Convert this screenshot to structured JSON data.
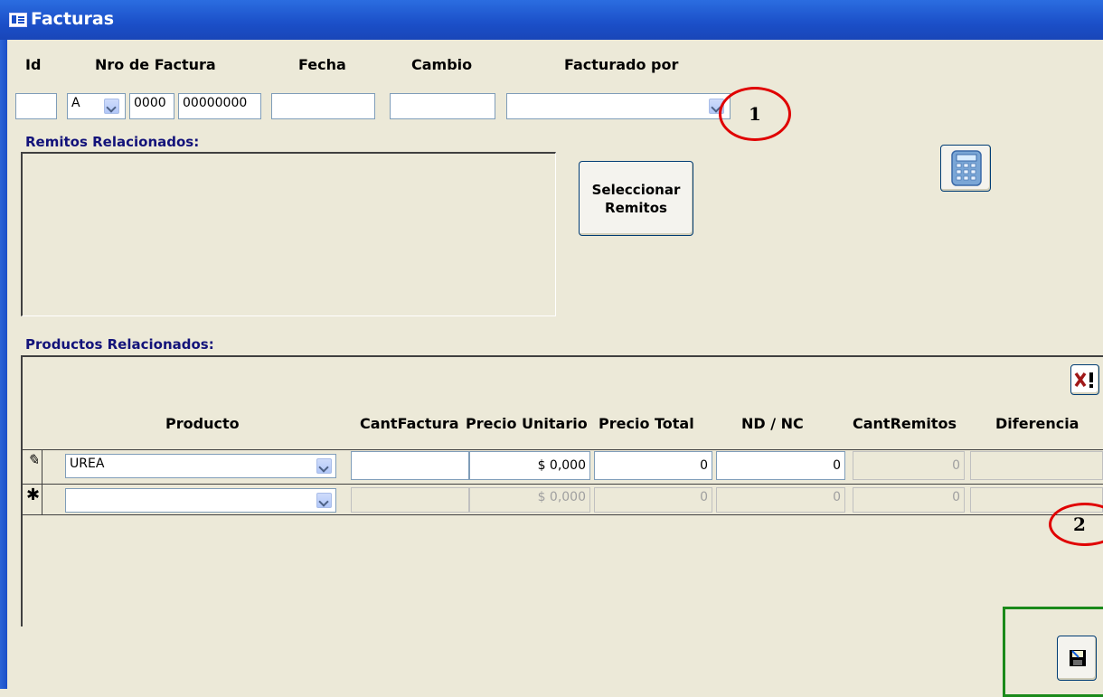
{
  "window": {
    "title": "Facturas"
  },
  "headers": {
    "id": "Id",
    "nro_factura": "Nro de Factura",
    "fecha": "Fecha",
    "cambio": "Cambio",
    "facturado_por": "Facturado por"
  },
  "fields": {
    "id": "",
    "tipo": "A",
    "punto_venta": "0000",
    "numero": "00000000",
    "fecha": "",
    "cambio": "",
    "facturado_por": ""
  },
  "remitos": {
    "label": "Remitos Relacionados:",
    "button": [
      "Seleccionar",
      "Remitos"
    ]
  },
  "productos": {
    "label": "Productos Relacionados:",
    "columns": [
      "Producto",
      "CantFactura",
      "Precio Unitario",
      "Precio Total",
      "ND / NC",
      "CantRemitos",
      "Diferencia"
    ],
    "rows": [
      {
        "selector": "✎",
        "producto": "UREA",
        "cant_factura": "",
        "precio_unitario": "$ 0,000",
        "precio_total": "0",
        "nd_nc": "0",
        "cant_remitos": "0",
        "diferencia": ""
      },
      {
        "selector": "✱",
        "producto": "",
        "cant_factura": "",
        "precio_unitario": "$ 0,000",
        "precio_total": "0",
        "nd_nc": "0",
        "cant_remitos": "0",
        "diferencia": ""
      }
    ]
  },
  "annotations": {
    "circle1": "1",
    "circle2": "2"
  },
  "icons": {
    "calculator": "calculator-icon",
    "delete": "delete-icon",
    "save": "save-icon"
  },
  "colors": {
    "titlebar": "#1b4fc8",
    "background": "#ece9d8",
    "section_label": "#13137a",
    "annotation_circle": "#e00000",
    "highlight_box": "#1a8a1a"
  }
}
